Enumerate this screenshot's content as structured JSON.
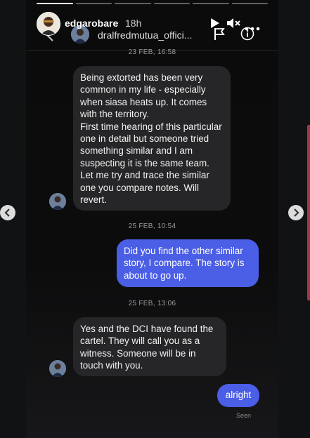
{
  "story": {
    "username": "edgarobare",
    "time": "18h",
    "progress_total": 6,
    "progress_active": 1
  },
  "chat": {
    "username": "dralfredmutua_offici...",
    "messages": [
      {
        "type": "date",
        "text": "23 FEB, 16:58"
      },
      {
        "type": "in",
        "paragraphs": [
          "Being extorted has been very common in my life - especially when siasa heats up. It comes with the territory.",
          "First time hearing of this particular one in detail but someone tried something similar and I am suspecting it is the same team. Let me try and trace the similar one you compare notes. Will revert."
        ]
      },
      {
        "type": "date",
        "text": "25 FEB, 10:54"
      },
      {
        "type": "out",
        "text": "Did you find the other similar story, I compare. The story is about to go up."
      },
      {
        "type": "date",
        "text": "25 FEB, 13:06"
      },
      {
        "type": "in",
        "text": "Yes and the DCI have found the cartel. They will call you as a witness. Someone will be in touch with you."
      },
      {
        "type": "out",
        "text": "alright"
      }
    ],
    "seen": "Seen"
  },
  "icons": {
    "play": "play-icon",
    "mute": "mute-icon",
    "more": "more-icon",
    "back": "back-arrow-icon",
    "flag": "flag-icon",
    "info": "info-icon",
    "prev": "chevron-left-icon",
    "next": "chevron-right-icon"
  },
  "colors": {
    "outgoing_bubble": "#4b5ee6",
    "incoming_bubble": "#262628",
    "background": "#111214"
  }
}
